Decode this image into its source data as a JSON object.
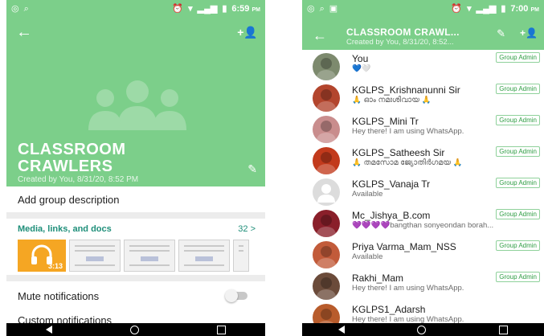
{
  "left": {
    "status_time": "6:59",
    "status_ampm": "PM",
    "group_name_line1": "CLASSROOM",
    "group_name_line2": "CRAWLERS",
    "created_by": "Created by You, 8/31/20, 8:52 PM",
    "add_description": "Add group description",
    "media_title": "Media, links, and docs",
    "media_count": "32 >",
    "audio_duration": "3:13",
    "mute_label": "Mute notifications",
    "custom_label": "Custom notifications"
  },
  "right": {
    "status_time": "7:00",
    "status_ampm": "PM",
    "title": "CLASSROOM CRAWL...",
    "subtitle": "Created by You, 8/31/20, 8:52...",
    "admin_badge": "Group Admin",
    "members": [
      {
        "name": "You",
        "status": "💙🤍",
        "admin": true,
        "avatar_color": "#7d8a6e"
      },
      {
        "name": "KGLPS_Krishnanunni Sir",
        "status": "🙏 ഓം നമഃശിവായ 🙏",
        "admin": true,
        "avatar_color": "#b3452d"
      },
      {
        "name": "KGLPS_Mini Tr",
        "status": "Hey there! I am using WhatsApp.",
        "admin": true,
        "avatar_color": "#c98d8d"
      },
      {
        "name": "KGLPS_Satheesh Sir",
        "status": "🙏 തമസോമ ജ്യോതിർഗമയ 🙏",
        "admin": true,
        "avatar_color": "#c23a1c"
      },
      {
        "name": "KGLPS_Vanaja Tr",
        "status": "Available",
        "admin": true,
        "avatar_color": "#dcdcdc"
      },
      {
        "name": "Mc_Jishya_B.com",
        "status": "💜💜💜💜bangthan sonyeondan borah...",
        "admin": true,
        "avatar_color": "#8a1f2a"
      },
      {
        "name": "Priya Varma_Mam_NSS",
        "status": "Available",
        "admin": true,
        "avatar_color": "#c25b3a"
      },
      {
        "name": "Rakhi_Mam",
        "status": "Hey there! I am using WhatsApp.",
        "admin": true,
        "avatar_color": "#6b4b3a"
      },
      {
        "name": "KGLPS1_Adarsh",
        "status": "Hey there! I am using WhatsApp.",
        "admin": false,
        "avatar_color": "#b85c2c"
      }
    ]
  },
  "colors": {
    "accent": "#7ccf8a",
    "link": "#1f8f7a",
    "badge": "#2e9d43"
  }
}
